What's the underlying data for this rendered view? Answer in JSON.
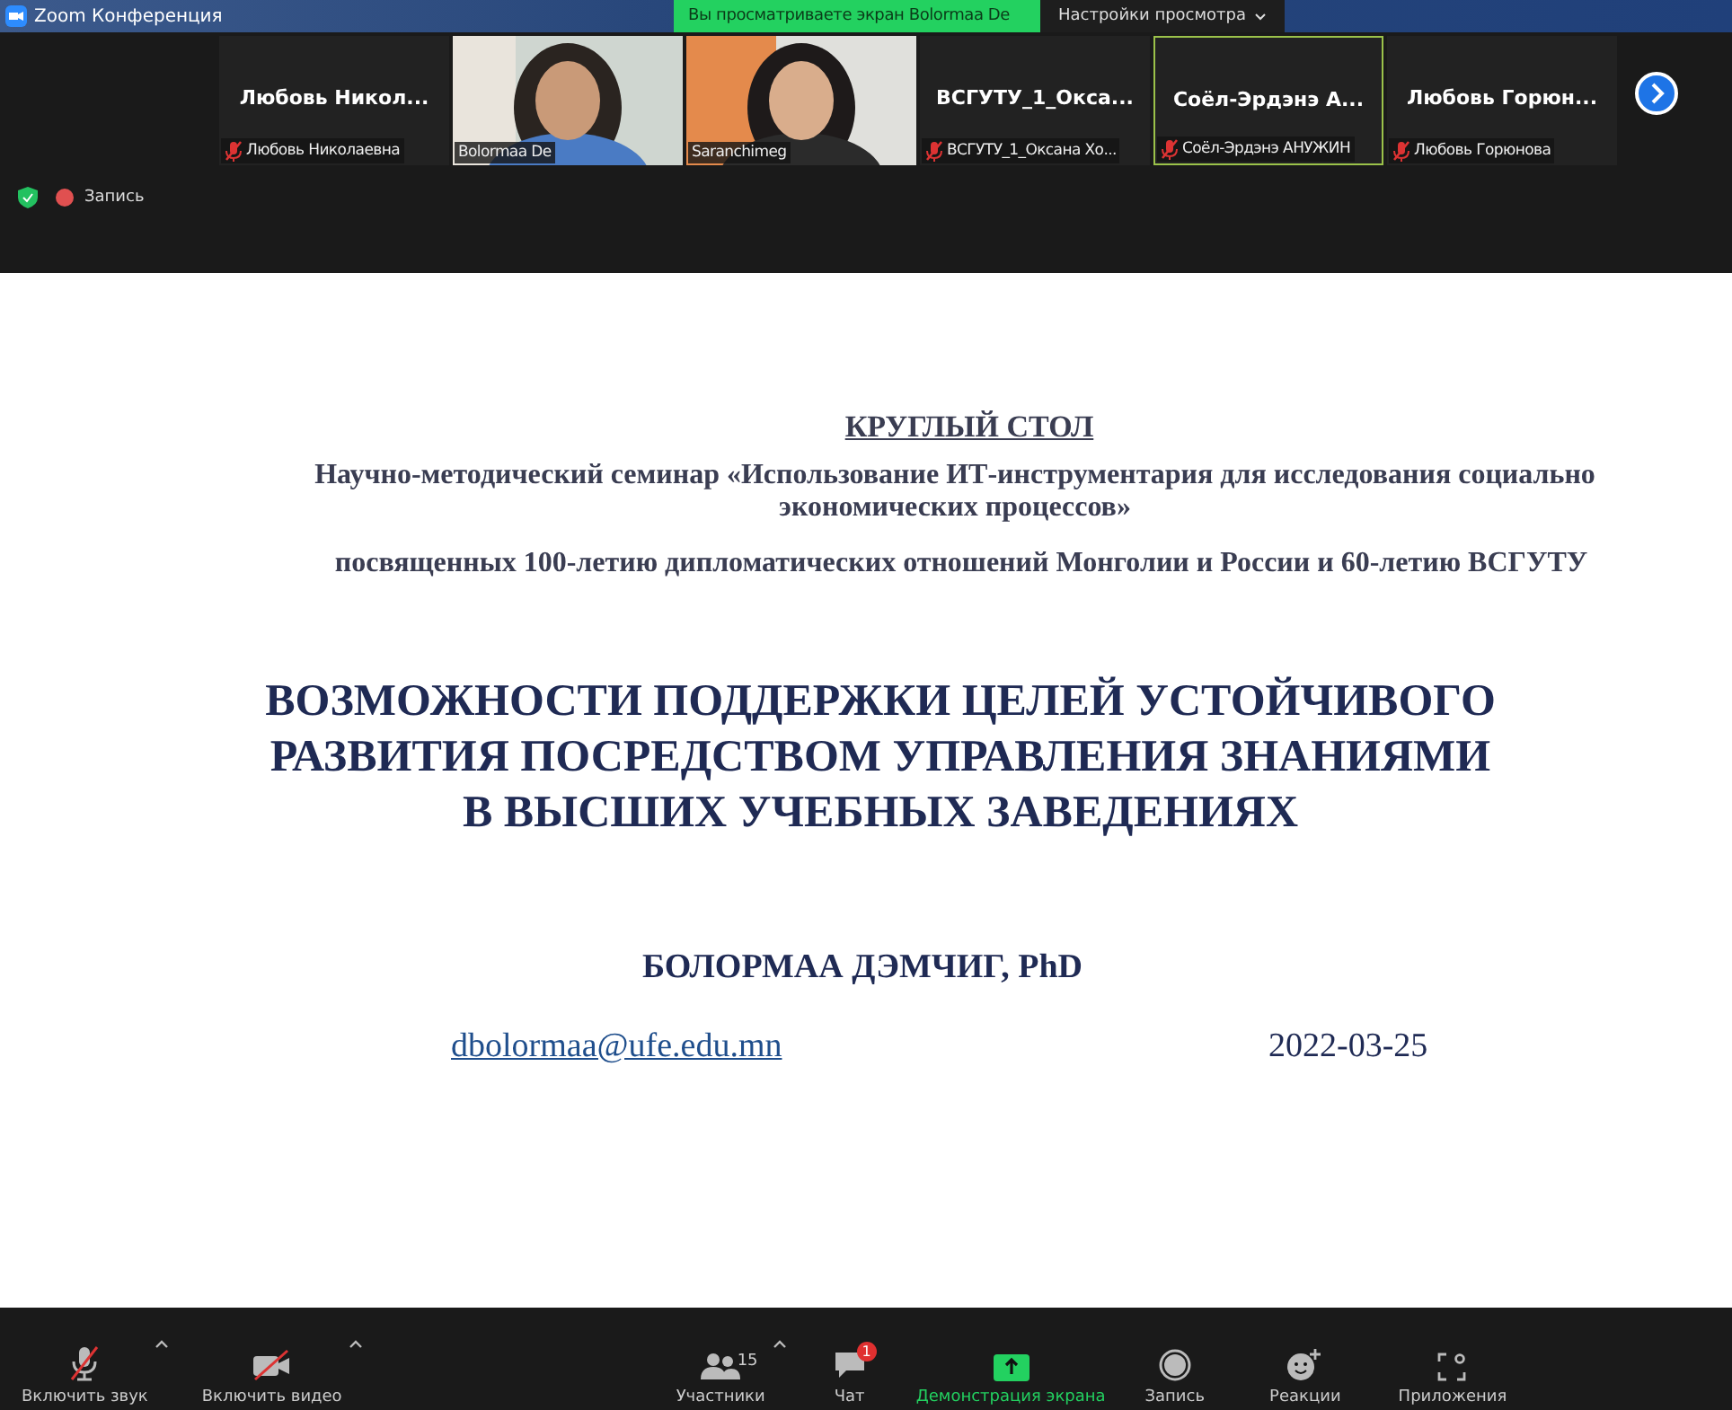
{
  "window": {
    "title": "Zoom Конференция"
  },
  "share_banner": {
    "text": "Вы просматриваете экран Bolormaa De"
  },
  "view_options": {
    "label": "Настройки просмотра"
  },
  "participants": [
    {
      "kind": "name",
      "display": "Любовь  Никол...",
      "label": "Любовь Николаевна",
      "muted": true,
      "speaking": false
    },
    {
      "kind": "video",
      "label": "Bolormaa De",
      "muted": false,
      "speaking": false
    },
    {
      "kind": "video",
      "label": "Saranchimeg",
      "muted": false,
      "speaking": false
    },
    {
      "kind": "name",
      "display": "ВСГУТУ_1_Окса...",
      "label": "ВСГУТУ_1_Оксана Хо...",
      "muted": true,
      "speaking": false
    },
    {
      "kind": "name",
      "display": "Соёл-Эрдэнэ  А...",
      "label": "Соёл-Эрдэнэ АНУЖИН",
      "muted": true,
      "speaking": true
    },
    {
      "kind": "name",
      "display": "Любовь  Горюн...",
      "label": "Любовь Горюнова",
      "muted": true,
      "speaking": false
    }
  ],
  "status": {
    "encrypted": true,
    "recording_label": "Запись"
  },
  "slide": {
    "heading": "КРУГЛЫЙ СТОЛ",
    "subtitle_lines": [
      "Научно-методический семинар «Использование ИТ-инструментария для исследования социально",
      "экономических процессов»"
    ],
    "dedication": "посвященных 100-летию дипломатических отношений Монголии и России и 60-летию ВСГУТУ",
    "title_lines": [
      "ВОЗМОЖНОСТИ ПОДДЕРЖКИ ЦЕЛЕЙ УСТОЙЧИВОГО",
      "РАЗВИТИЯ ПОСРЕДСТВОМ УПРАВЛЕНИЯ ЗНАНИЯМИ",
      "В ВЫСШИХ УЧЕБНЫХ ЗАВЕДЕНИЯХ"
    ],
    "author": "БОЛОРМАА ДЭМЧИГ,  PhD",
    "email": "dbolormaa@ufe.edu.mn",
    "date": "2022-03-25"
  },
  "toolbar": [
    {
      "kind": "mic",
      "label": "Включить звук",
      "caret": true
    },
    {
      "kind": "video",
      "label": "Включить видео",
      "caret": true
    },
    {
      "kind": "participants",
      "label": "Участники",
      "count": "15",
      "caret": true
    },
    {
      "kind": "chat",
      "label": "Чат",
      "badge": "1"
    },
    {
      "kind": "share",
      "label": "Демонстрация экрана",
      "active": true
    },
    {
      "kind": "record",
      "label": "Запись"
    },
    {
      "kind": "reactions",
      "label": "Реакции"
    },
    {
      "kind": "apps",
      "label": "Приложения"
    }
  ]
}
